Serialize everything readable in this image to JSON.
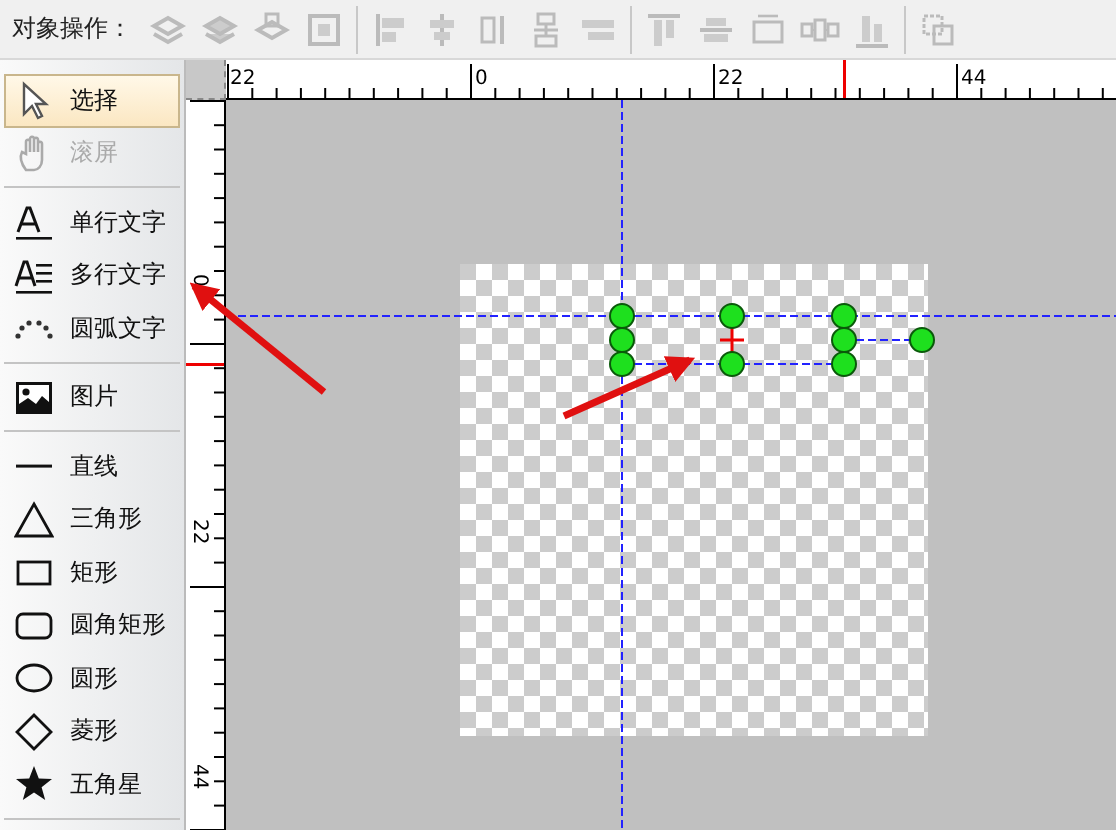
{
  "toolbar": {
    "label": "对象操作："
  },
  "tool_groups": [
    [
      {
        "kind": "select",
        "label": "选择",
        "selected": true,
        "disabled": false
      },
      {
        "kind": "pan",
        "label": "滚屏",
        "selected": false,
        "disabled": true
      }
    ],
    [
      {
        "kind": "text",
        "label": "单行文字",
        "selected": false,
        "disabled": false
      },
      {
        "kind": "multitext",
        "label": "多行文字",
        "selected": false,
        "disabled": false
      },
      {
        "kind": "arctext",
        "label": "圆弧文字",
        "selected": false,
        "disabled": false
      }
    ],
    [
      {
        "kind": "image",
        "label": "图片",
        "selected": false,
        "disabled": false
      }
    ],
    [
      {
        "kind": "line",
        "label": "直线",
        "selected": false,
        "disabled": false
      },
      {
        "kind": "triangle",
        "label": "三角形",
        "selected": false,
        "disabled": false
      },
      {
        "kind": "rect",
        "label": "矩形",
        "selected": false,
        "disabled": false
      },
      {
        "kind": "roundrect",
        "label": "圆角矩形",
        "selected": false,
        "disabled": false
      },
      {
        "kind": "ellipse",
        "label": "圆形",
        "selected": false,
        "disabled": false
      },
      {
        "kind": "diamond",
        "label": "菱形",
        "selected": false,
        "disabled": false
      },
      {
        "kind": "star",
        "label": "五角星",
        "selected": false,
        "disabled": false
      }
    ]
  ],
  "horizontal_ruler": {
    "labels": [
      "22",
      "0",
      "22",
      "44"
    ]
  },
  "vertical_ruler": {
    "labels": [
      "0",
      "22",
      "44"
    ]
  }
}
